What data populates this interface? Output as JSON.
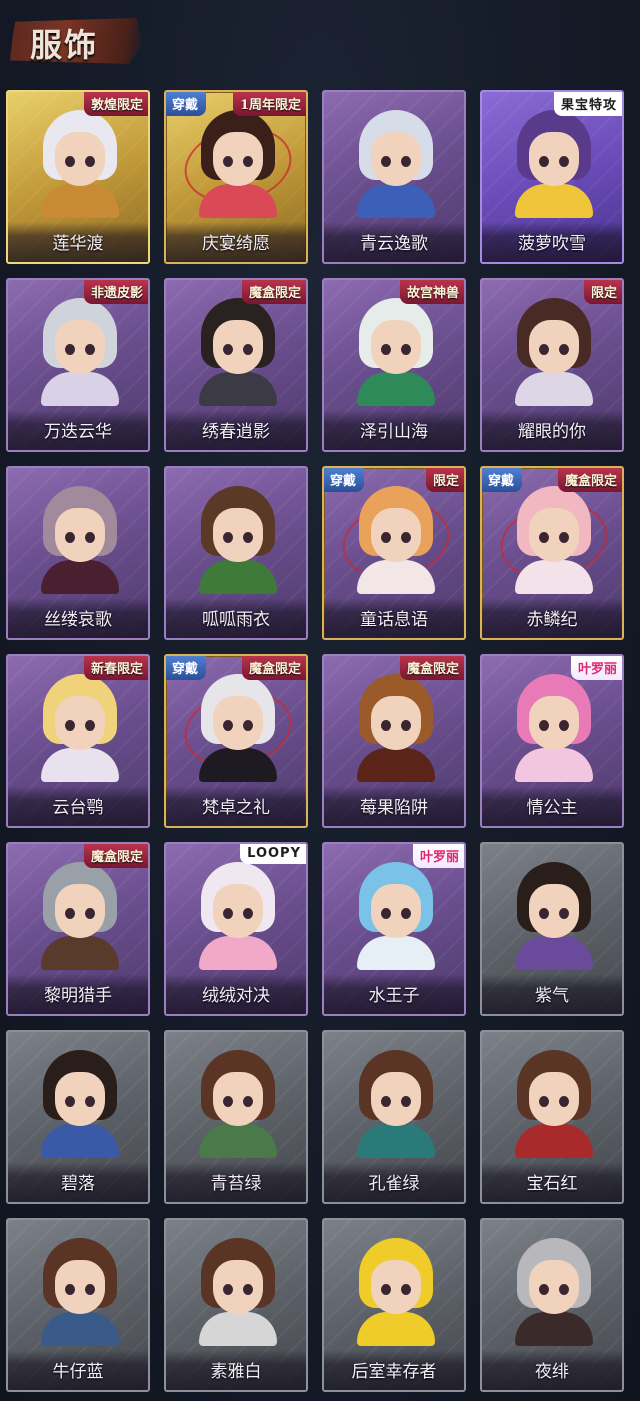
{
  "header": {
    "title": "服饰"
  },
  "badges": {
    "equipped_label": "穿戴"
  },
  "costumes": [
    {
      "name": "莲华渡",
      "tier": "gold",
      "tag": "敦煌限定",
      "tag_style": "ribbon",
      "equipped": false,
      "hair": "#e9e7ef",
      "outfit": "#c98a36"
    },
    {
      "name": "庆宴绮愿",
      "tier": "gold",
      "tag": "1周年限定",
      "tag_style": "ribbon",
      "equipped": true,
      "hair": "#3a2018",
      "outfit": "#d94a56"
    },
    {
      "name": "青云逸歌",
      "tier": "purple",
      "tag": "",
      "tag_style": "",
      "equipped": false,
      "hair": "#d7dde8",
      "outfit": "#3c5fb8"
    },
    {
      "name": "菠萝吹雪",
      "tier": "violet",
      "tag": "果宝特攻",
      "tag_style": "logo",
      "equipped": false,
      "hair": "#5a3a8a",
      "outfit": "#f0c53a"
    },
    {
      "name": "万迭云华",
      "tier": "purple",
      "tag": "非遗皮影",
      "tag_style": "ribbon",
      "equipped": false,
      "hair": "#cfd3dc",
      "outfit": "#d9d2e6"
    },
    {
      "name": "绣春逍影",
      "tier": "purple",
      "tag": "魔盒限定",
      "tag_style": "ribbon",
      "equipped": false,
      "hair": "#2a2220",
      "outfit": "#3c3a44"
    },
    {
      "name": "泽引山海",
      "tier": "purple",
      "tag": "故宫神兽",
      "tag_style": "ribbon",
      "equipped": false,
      "hair": "#e6ecea",
      "outfit": "#2f8a5a"
    },
    {
      "name": "耀眼的你",
      "tier": "purple",
      "tag": "限定",
      "tag_style": "ribbon",
      "equipped": false,
      "hair": "#4a2a24",
      "outfit": "#dcd6e6"
    },
    {
      "name": "丝缕哀歌",
      "tier": "purple",
      "tag": "",
      "tag_style": "",
      "equipped": false,
      "hair": "#a08a9c",
      "outfit": "#4a2030"
    },
    {
      "name": "呱呱雨衣",
      "tier": "purple",
      "tag": "",
      "tag_style": "",
      "equipped": false,
      "hair": "#5a3a26",
      "outfit": "#3f7a3a"
    },
    {
      "name": "童话息语",
      "tier": "purple",
      "tag": "限定",
      "tag_style": "ribbon",
      "equipped": true,
      "hair": "#e8a25a",
      "outfit": "#f3e6e6"
    },
    {
      "name": "赤鳞纪",
      "tier": "purple",
      "tag": "魔盒限定",
      "tag_style": "ribbon",
      "equipped": true,
      "hair": "#f2b8c2",
      "outfit": "#f3e2ea"
    },
    {
      "name": "云台鹗",
      "tier": "purple",
      "tag": "新春限定",
      "tag_style": "ribbon",
      "equipped": false,
      "hair": "#f0d27a",
      "outfit": "#e8e2ee"
    },
    {
      "name": "梵卓之礼",
      "tier": "purple",
      "tag": "魔盒限定",
      "tag_style": "ribbon",
      "equipped": true,
      "hair": "#e6e6ea",
      "outfit": "#1e1a22"
    },
    {
      "name": "莓果陷阱",
      "tier": "purple",
      "tag": "魔盒限定",
      "tag_style": "ribbon",
      "equipped": false,
      "hair": "#9a5a2a",
      "outfit": "#5a2418"
    },
    {
      "name": "情公主",
      "tier": "purple",
      "tag": "叶罗丽",
      "tag_style": "brand",
      "equipped": false,
      "hair": "#e87ab8",
      "outfit": "#f2c6de"
    },
    {
      "name": "黎明猎手",
      "tier": "purple",
      "tag": "魔盒限定",
      "tag_style": "ribbon",
      "equipped": false,
      "hair": "#9aa0a8",
      "outfit": "#5a3a2a"
    },
    {
      "name": "绒绒对决",
      "tier": "purple",
      "tag": "LOOPY",
      "tag_style": "logo",
      "equipped": false,
      "hair": "#f0e8f0",
      "outfit": "#f2a8c8"
    },
    {
      "name": "水王子",
      "tier": "purple",
      "tag": "叶罗丽",
      "tag_style": "brand",
      "equipped": false,
      "hair": "#7ac2e8",
      "outfit": "#e6eef6"
    },
    {
      "name": "紫气",
      "tier": "gray",
      "tag": "",
      "tag_style": "",
      "equipped": false,
      "hair": "#2a1e1a",
      "outfit": "#6a4a9a"
    },
    {
      "name": "碧落",
      "tier": "gray",
      "tag": "",
      "tag_style": "",
      "equipped": false,
      "hair": "#2a1e1a",
      "outfit": "#3a5aa8"
    },
    {
      "name": "青苔绿",
      "tier": "gray",
      "tag": "",
      "tag_style": "",
      "equipped": false,
      "hair": "#5a3424",
      "outfit": "#4a7a4a"
    },
    {
      "name": "孔雀绿",
      "tier": "gray",
      "tag": "",
      "tag_style": "",
      "equipped": false,
      "hair": "#5a3424",
      "outfit": "#2a7a7a"
    },
    {
      "name": "宝石红",
      "tier": "gray",
      "tag": "",
      "tag_style": "",
      "equipped": false,
      "hair": "#5a3424",
      "outfit": "#a82a2a"
    },
    {
      "name": "牛仔蓝",
      "tier": "gray",
      "tag": "",
      "tag_style": "",
      "equipped": false,
      "hair": "#5a3424",
      "outfit": "#3a5a8a"
    },
    {
      "name": "素雅白",
      "tier": "gray",
      "tag": "",
      "tag_style": "",
      "equipped": false,
      "hair": "#5a3424",
      "outfit": "#d6d6d6"
    },
    {
      "name": "后室幸存者",
      "tier": "gray",
      "tag": "",
      "tag_style": "",
      "equipped": false,
      "hair": "#f0cc2a",
      "outfit": "#f0cc2a"
    },
    {
      "name": "夜绯",
      "tier": "gray",
      "tag": "",
      "tag_style": "",
      "equipped": false,
      "hair": "#b8b8bc",
      "outfit": "#3a2a2a"
    }
  ]
}
